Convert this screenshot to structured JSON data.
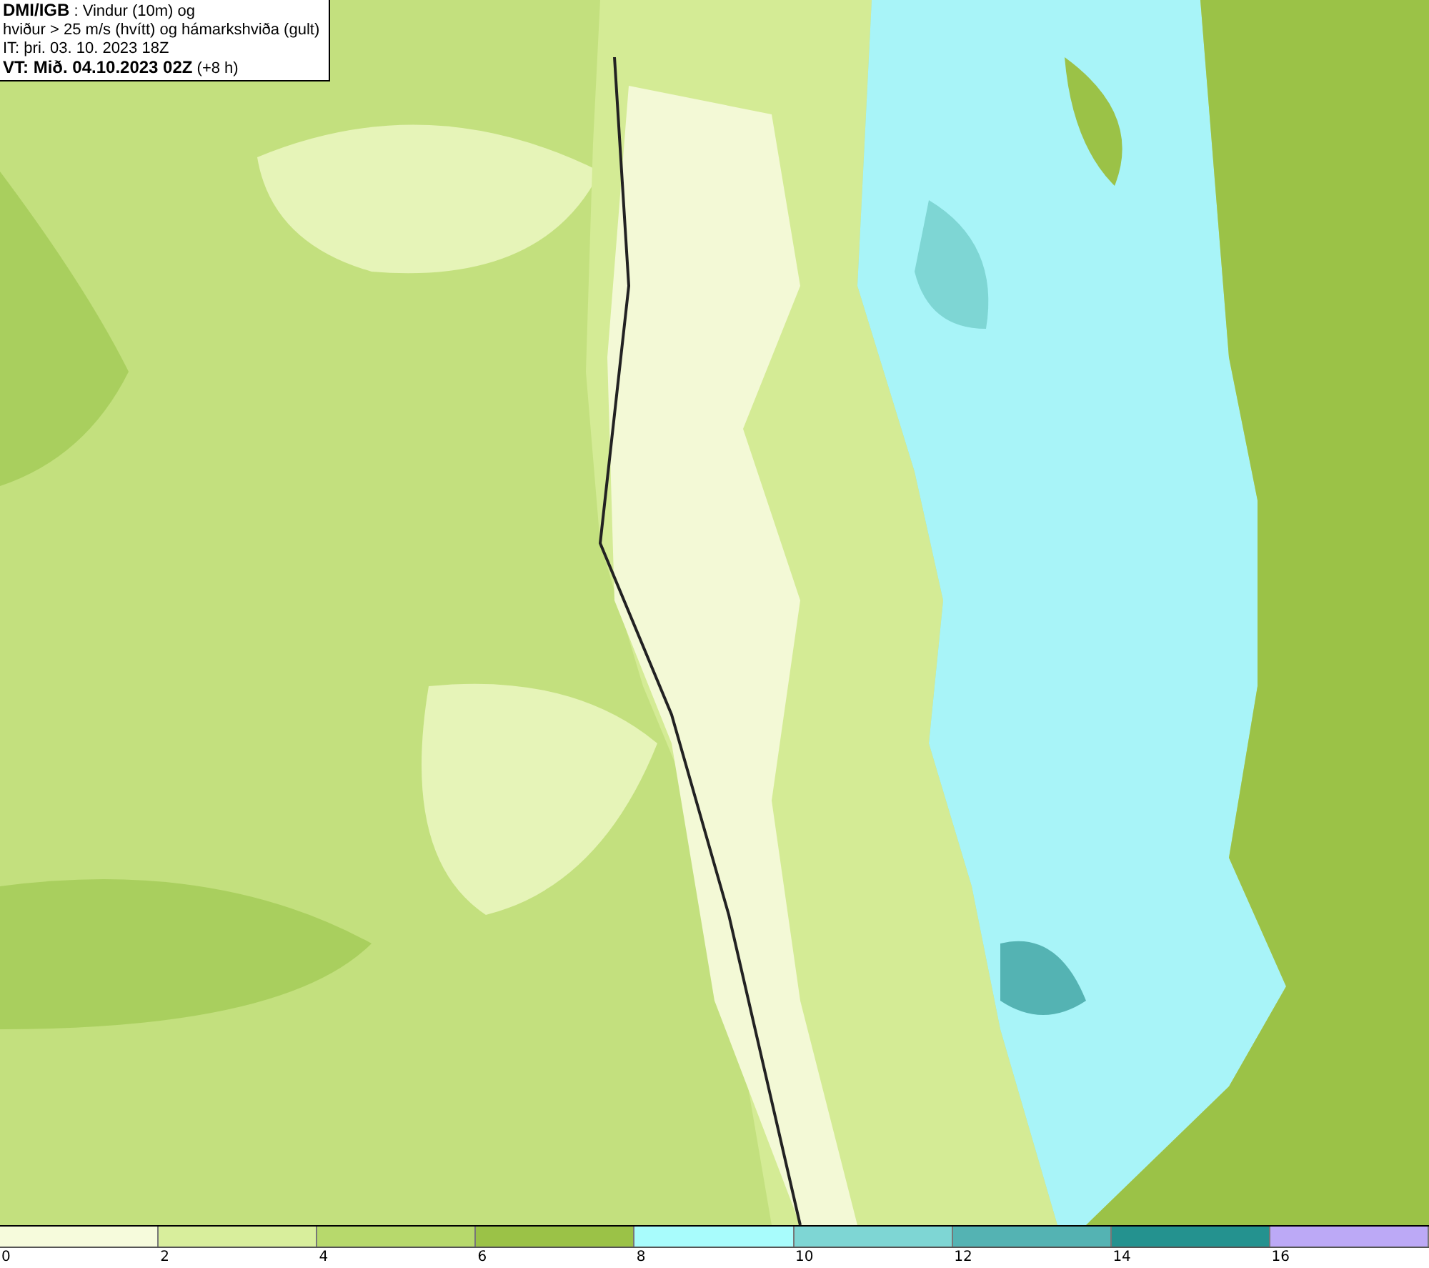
{
  "title_box": {
    "source": "DMI/IGB",
    "line_1": " : Vindur (10m) og",
    "line_2": "hviður > 25 m/s (hvítt) og hámarkshviða (gult)",
    "line_3": "IT: þri. 03. 10. 2023 18Z",
    "line_4_bold": "VT: Mið. 04.10.2023 02Z",
    "line_4_rest": " (+8 h)"
  },
  "legend": {
    "bins": [
      {
        "color": "#f6fbdc"
      },
      {
        "color": "#d8ee9c"
      },
      {
        "color": "#b7d96c"
      },
      {
        "color": "#9bc247"
      },
      {
        "color": "#a8fcfc"
      },
      {
        "color": "#7ed6d4"
      },
      {
        "color": "#54b3b3"
      },
      {
        "color": "#24928f"
      },
      {
        "color": "#bca9f6"
      }
    ],
    "ticks": [
      "0",
      "2",
      "4",
      "6",
      "8",
      "10",
      "12",
      "14",
      "16"
    ]
  }
}
